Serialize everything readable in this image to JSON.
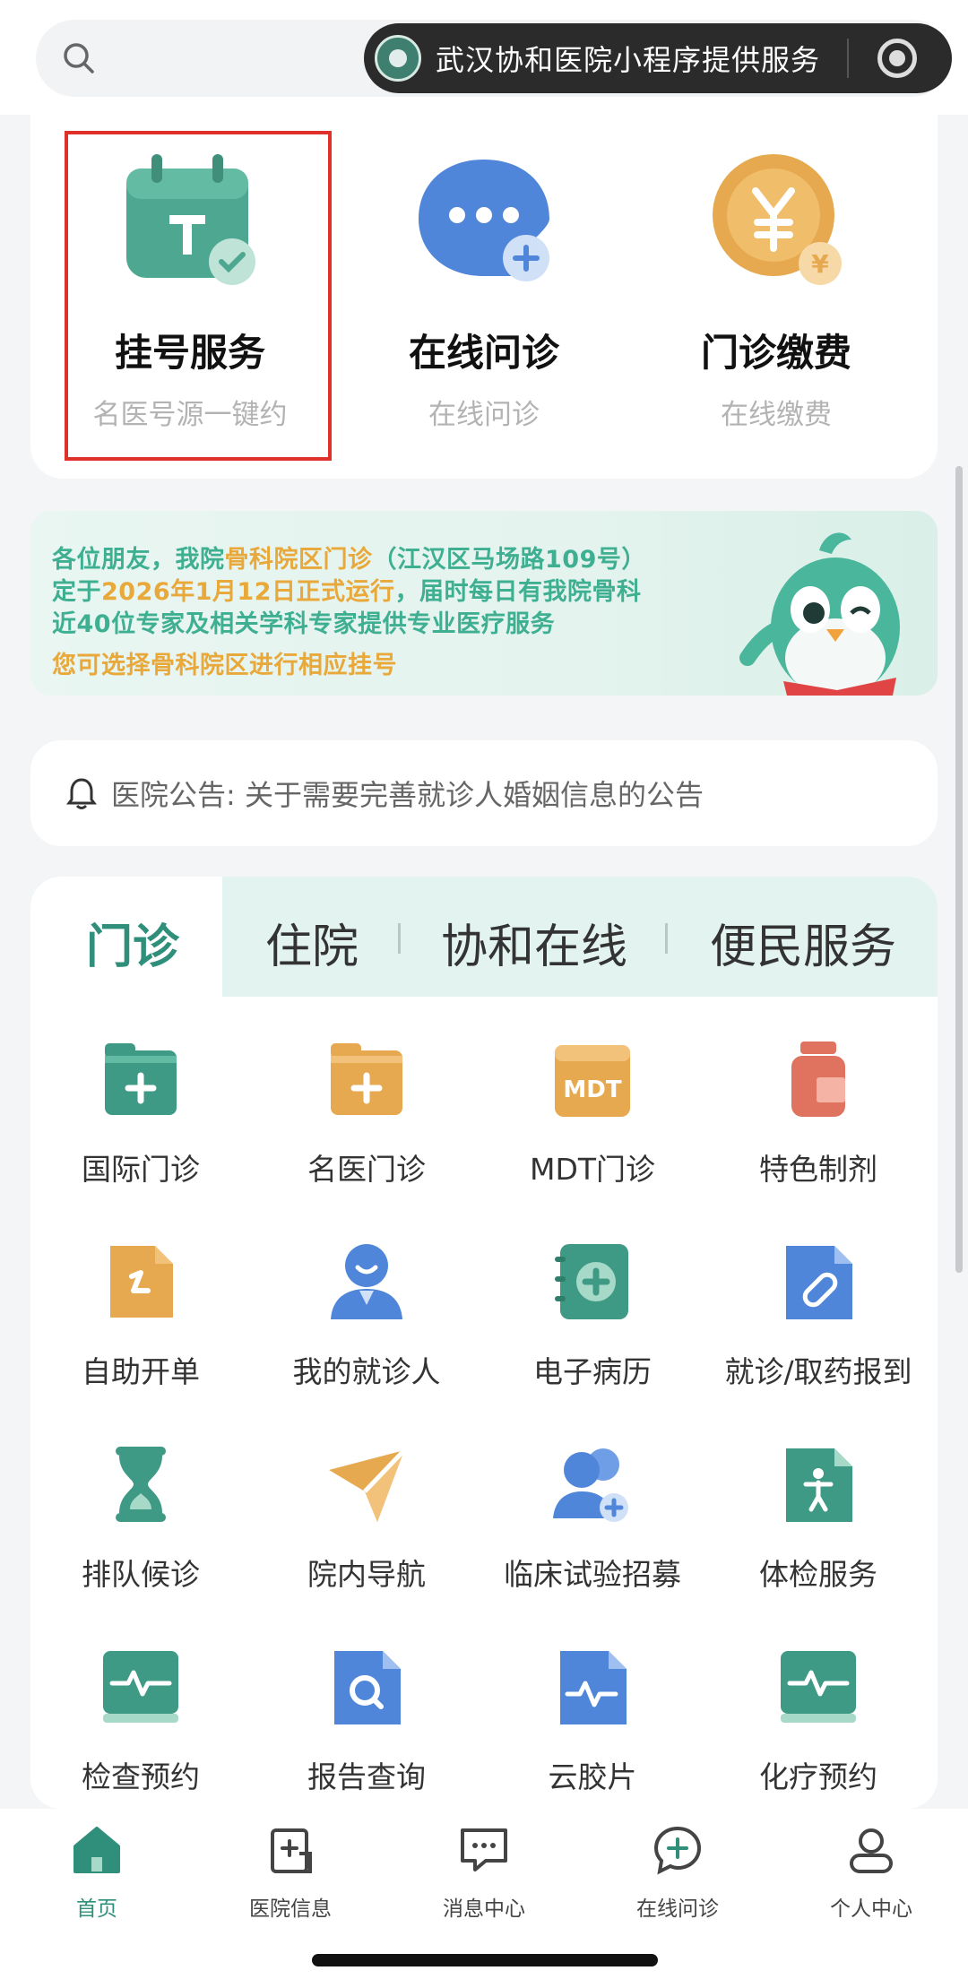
{
  "header": {
    "capsule_title": "武汉协和医院小程序提供服务"
  },
  "services": [
    {
      "name": "挂号服务",
      "sub": "名医号源一键约",
      "icon": "calendar-check-icon",
      "color": "#4ea891"
    },
    {
      "name": "在线问诊",
      "sub": "在线问诊",
      "icon": "chat-bubble-plus-icon",
      "color": "#4f86d9"
    },
    {
      "name": "门诊缴费",
      "sub": "在线缴费",
      "icon": "yen-coin-icon",
      "color": "#e6a94f"
    }
  ],
  "banner": {
    "line1_pre": "各位朋友，我院",
    "line1_hl": "骨科院区门诊",
    "line1_post": "（江汉区马场路109号）",
    "line2_pre": "定于",
    "line2_hl": "2026年1月12日正式运行",
    "line2_post": "，届时每日有我院骨科",
    "line3": "近40位专家及相关学科专家提供专业医疗服务",
    "line4": "您可选择骨科院区进行相应挂号",
    "mascot": "green-bird-mascot-icon"
  },
  "notice": {
    "text": "医院公告: 关于需要完善就诊人婚姻信息的公告"
  },
  "tabs": [
    "门诊",
    "住院",
    "协和在线",
    "便民服务"
  ],
  "grid": [
    {
      "label": "国际门诊",
      "icon": "folder-plus-icon",
      "color": "#3f9a85"
    },
    {
      "label": "名医门诊",
      "icon": "folder-plus-icon",
      "color": "#e6a94f"
    },
    {
      "label": "MDT门诊",
      "icon": "mdt-calendar-icon",
      "color": "#e6a94f"
    },
    {
      "label": "特色制剂",
      "icon": "medicine-bottle-icon",
      "color": "#e0735f"
    },
    {
      "label": "自助开单",
      "icon": "document-pen-icon",
      "color": "#e6a94f"
    },
    {
      "label": "我的就诊人",
      "icon": "person-icon",
      "color": "#4f86d9"
    },
    {
      "label": "电子病历",
      "icon": "medical-record-icon",
      "color": "#3f9a85"
    },
    {
      "label": "就诊/取药报到",
      "icon": "pill-document-icon",
      "color": "#4f86d9"
    },
    {
      "label": "排队候诊",
      "icon": "hourglass-icon",
      "color": "#3f9a85"
    },
    {
      "label": "院内导航",
      "icon": "paper-plane-icon",
      "color": "#e6a94f"
    },
    {
      "label": "临床试验招募",
      "icon": "people-plus-icon",
      "color": "#4f86d9"
    },
    {
      "label": "体检服务",
      "icon": "body-check-icon",
      "color": "#3f9a85"
    },
    {
      "label": "检查预约",
      "icon": "ecg-monitor-icon",
      "color": "#3f9a85"
    },
    {
      "label": "报告查询",
      "icon": "search-report-icon",
      "color": "#4f86d9"
    },
    {
      "label": "云胶片",
      "icon": "pulse-document-icon",
      "color": "#4f86d9"
    },
    {
      "label": "化疗预约",
      "icon": "ecg-monitor-icon",
      "color": "#3f9a85"
    }
  ],
  "bottom_nav": [
    {
      "label": "首页",
      "icon": "home-icon",
      "active": true
    },
    {
      "label": "医院信息",
      "icon": "hospital-info-icon",
      "active": false
    },
    {
      "label": "消息中心",
      "icon": "message-icon",
      "active": false
    },
    {
      "label": "在线问诊",
      "icon": "consult-plus-icon",
      "active": false
    },
    {
      "label": "个人中心",
      "icon": "user-icon",
      "active": false
    }
  ],
  "colors": {
    "brand": "#2f8f7b",
    "highlight": "#e0302a",
    "banner_text": "#3faf92",
    "banner_accent": "#e8a83a"
  }
}
